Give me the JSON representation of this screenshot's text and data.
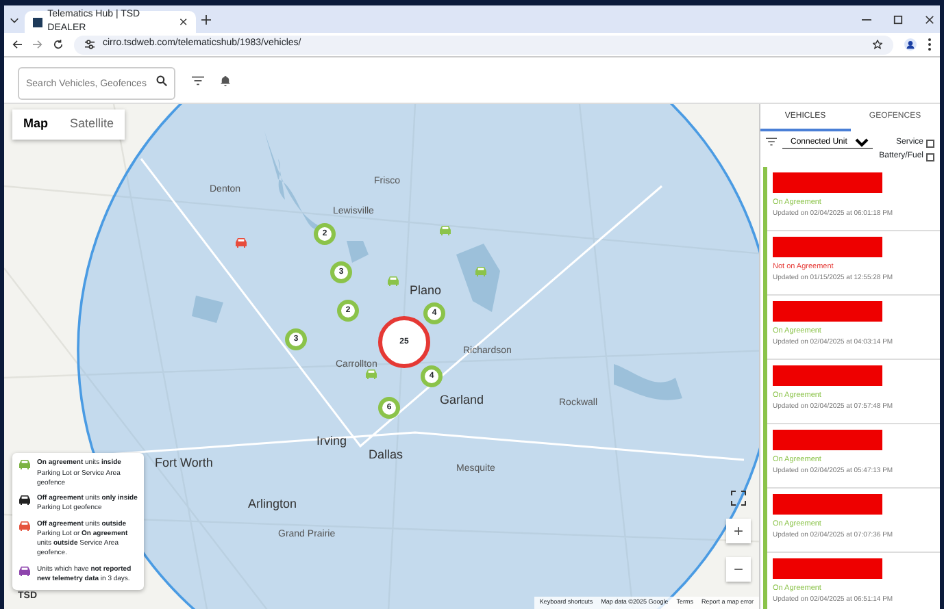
{
  "browser": {
    "tab_title": "Telematics Hub | TSD DEALER",
    "url": "cirro.tsdweb.com/telematicshub/1983/vehicles/"
  },
  "header": {
    "search": {
      "placeholder": "Search Vehicles, Geofences"
    }
  },
  "map": {
    "map_types": [
      {
        "label": "Map",
        "selected": true
      },
      {
        "label": "Satellite",
        "selected": false
      }
    ],
    "places": [
      "Frisco",
      "Denton",
      "Lewisville",
      "Plano",
      "Richardson",
      "Carrollton",
      "Garland",
      "Rockwall",
      "Irving",
      "Dallas",
      "Fort Worth",
      "Mesquite",
      "Arlington",
      "Grand Prairie"
    ],
    "zoom_controls": [
      "+",
      "−"
    ],
    "clusters": [
      {
        "count": "2",
        "kind": "group"
      },
      {
        "count": "3",
        "kind": "group"
      },
      {
        "count": "2",
        "kind": "group"
      },
      {
        "count": "3",
        "kind": "group"
      },
      {
        "count": "25",
        "kind": "alert"
      },
      {
        "count": "4",
        "kind": "group"
      },
      {
        "count": "4",
        "kind": "group"
      },
      {
        "count": "6",
        "kind": "group"
      }
    ],
    "vehicles": [
      {
        "color": "#e74c3c"
      },
      {
        "color": "#8bc34a"
      },
      {
        "color": "#8bc34a"
      },
      {
        "color": "#8bc34a"
      },
      {
        "color": "#8bc34a"
      }
    ],
    "legend": [
      {
        "color": "#7cb342",
        "text": "**On agreement** units **inside** Parking Lot or Service Area geofence"
      },
      {
        "color": "#222222",
        "text": "**Off agreement** units **only inside** Parking Lot geofence"
      },
      {
        "color": "#e5533d",
        "text": "**Off agreement** units **outside** Parking Lot or **On agreement** units **outside** Service Area geofence."
      },
      {
        "color": "#8e44ad",
        "text": "Units which have **not reported new telemetry data** in 3 days."
      }
    ],
    "logo": "TSD",
    "attribution": [
      "Keyboard shortcuts",
      "Map data ©2025 Google",
      "Terms",
      "Report a map error"
    ]
  },
  "sidebar": {
    "tabs": [
      {
        "label": "VEHICLES",
        "selected": true
      },
      {
        "label": "GEOFENCES",
        "selected": false
      }
    ],
    "filter": {
      "value": "Connected Unit"
    },
    "options": [
      {
        "label": "Service",
        "checked": false
      },
      {
        "label": "Battery/Fuel",
        "checked": false
      }
    ],
    "vehicles": [
      {
        "on_agreement": true,
        "status": "On Agreement",
        "updated": "Updated on 02/04/2025 at 06:01:18 PM"
      },
      {
        "on_agreement": false,
        "status": "Not on Agreement",
        "updated": "Updated on 01/15/2025 at 12:55:28 PM"
      },
      {
        "on_agreement": true,
        "status": "On Agreement",
        "updated": "Updated on 02/04/2025 at 04:03:14 PM"
      },
      {
        "on_agreement": true,
        "status": "On Agreement",
        "updated": "Updated on 02/04/2025 at 07:57:48 PM"
      },
      {
        "on_agreement": true,
        "status": "On Agreement",
        "updated": "Updated on 02/04/2025 at 05:47:13 PM"
      },
      {
        "on_agreement": true,
        "status": "On Agreement",
        "updated": "Updated on 02/04/2025 at 07:07:36 PM"
      },
      {
        "on_agreement": true,
        "status": "On Agreement",
        "updated": "Updated on 02/04/2025 at 06:51:14 PM"
      }
    ]
  }
}
